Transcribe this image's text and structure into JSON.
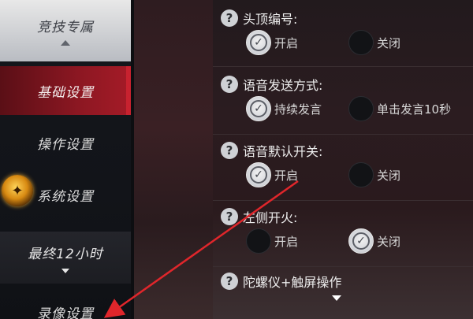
{
  "sidebar": {
    "top_label": "竞技专属",
    "items": [
      {
        "label": "基础设置"
      },
      {
        "label": "操作设置"
      },
      {
        "label": "系统设置"
      }
    ],
    "last_label": "最终12小时",
    "bottom_label": "录像设置"
  },
  "settings": [
    {
      "title": "头顶编号:",
      "options": [
        {
          "label": "开启",
          "checked": true
        },
        {
          "label": "关闭",
          "checked": false
        }
      ]
    },
    {
      "title": "语音发送方式:",
      "options": [
        {
          "label": "持续发言",
          "checked": true
        },
        {
          "label": "单击发言10秒",
          "checked": false
        }
      ]
    },
    {
      "title": "语音默认开关:",
      "options": [
        {
          "label": "开启",
          "checked": true
        },
        {
          "label": "关闭",
          "checked": false
        }
      ]
    },
    {
      "title": "左侧开火:",
      "options": [
        {
          "label": "开启",
          "checked": false
        },
        {
          "label": "关闭",
          "checked": true
        }
      ]
    },
    {
      "title": "陀螺仪+触屏操作",
      "options": []
    }
  ],
  "icons": {
    "help": "?",
    "check": "✓"
  },
  "colors": {
    "active_tab": "#a51b27",
    "annotation_arrow": "#e0262b"
  }
}
